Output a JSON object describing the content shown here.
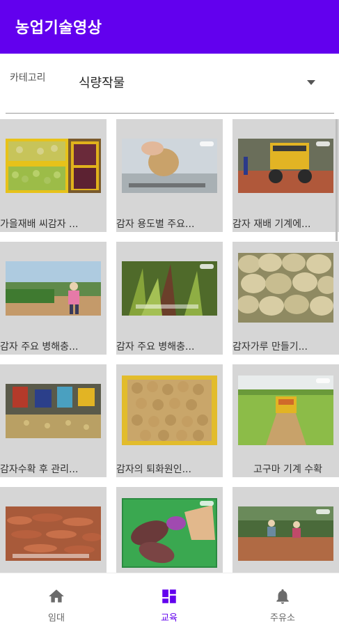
{
  "app": {
    "title": "농업기술영상",
    "accent_color": "#6200ee"
  },
  "filter": {
    "label": "카테고리",
    "selected": "식량작물",
    "caret_icon": "dropdown-caret-icon"
  },
  "videos": [
    {
      "caption": "가을재배 씨감자 ...",
      "thumb": "green-potatoes-crates"
    },
    {
      "caption": "감자 용도별 주요...",
      "thumb": "hand-holding-potato"
    },
    {
      "caption": "감자 재배 기계에...",
      "thumb": "yellow-planting-machine"
    },
    {
      "caption": "감자 주요 병해충...",
      "thumb": "farmer-in-field"
    },
    {
      "caption": "감자 주요 병해충...",
      "thumb": "diseased-potato-plant"
    },
    {
      "caption": "감자가루 만들기...",
      "thumb": "pile-of-potatoes"
    },
    {
      "caption": "감자수확 후 관리...",
      "thumb": "workers-sorting-potatoes"
    },
    {
      "caption": "감자의 퇴화원인...",
      "thumb": "potatoes-in-yellow-box"
    },
    {
      "caption": "고구마 기계 수확",
      "thumb": "sweet-potato-harvester"
    },
    {
      "caption": "",
      "thumb": "sweet-potatoes-on-ground"
    },
    {
      "caption": "",
      "thumb": "purple-sweet-potatoes-in-hand"
    },
    {
      "caption": "",
      "thumb": "workers-in-sweet-potato-field"
    }
  ],
  "bottom_nav": [
    {
      "label": "임대",
      "icon": "home-icon",
      "active": false
    },
    {
      "label": "교육",
      "icon": "dashboard-icon",
      "active": true
    },
    {
      "label": "주유소",
      "icon": "bell-icon",
      "active": false
    }
  ]
}
